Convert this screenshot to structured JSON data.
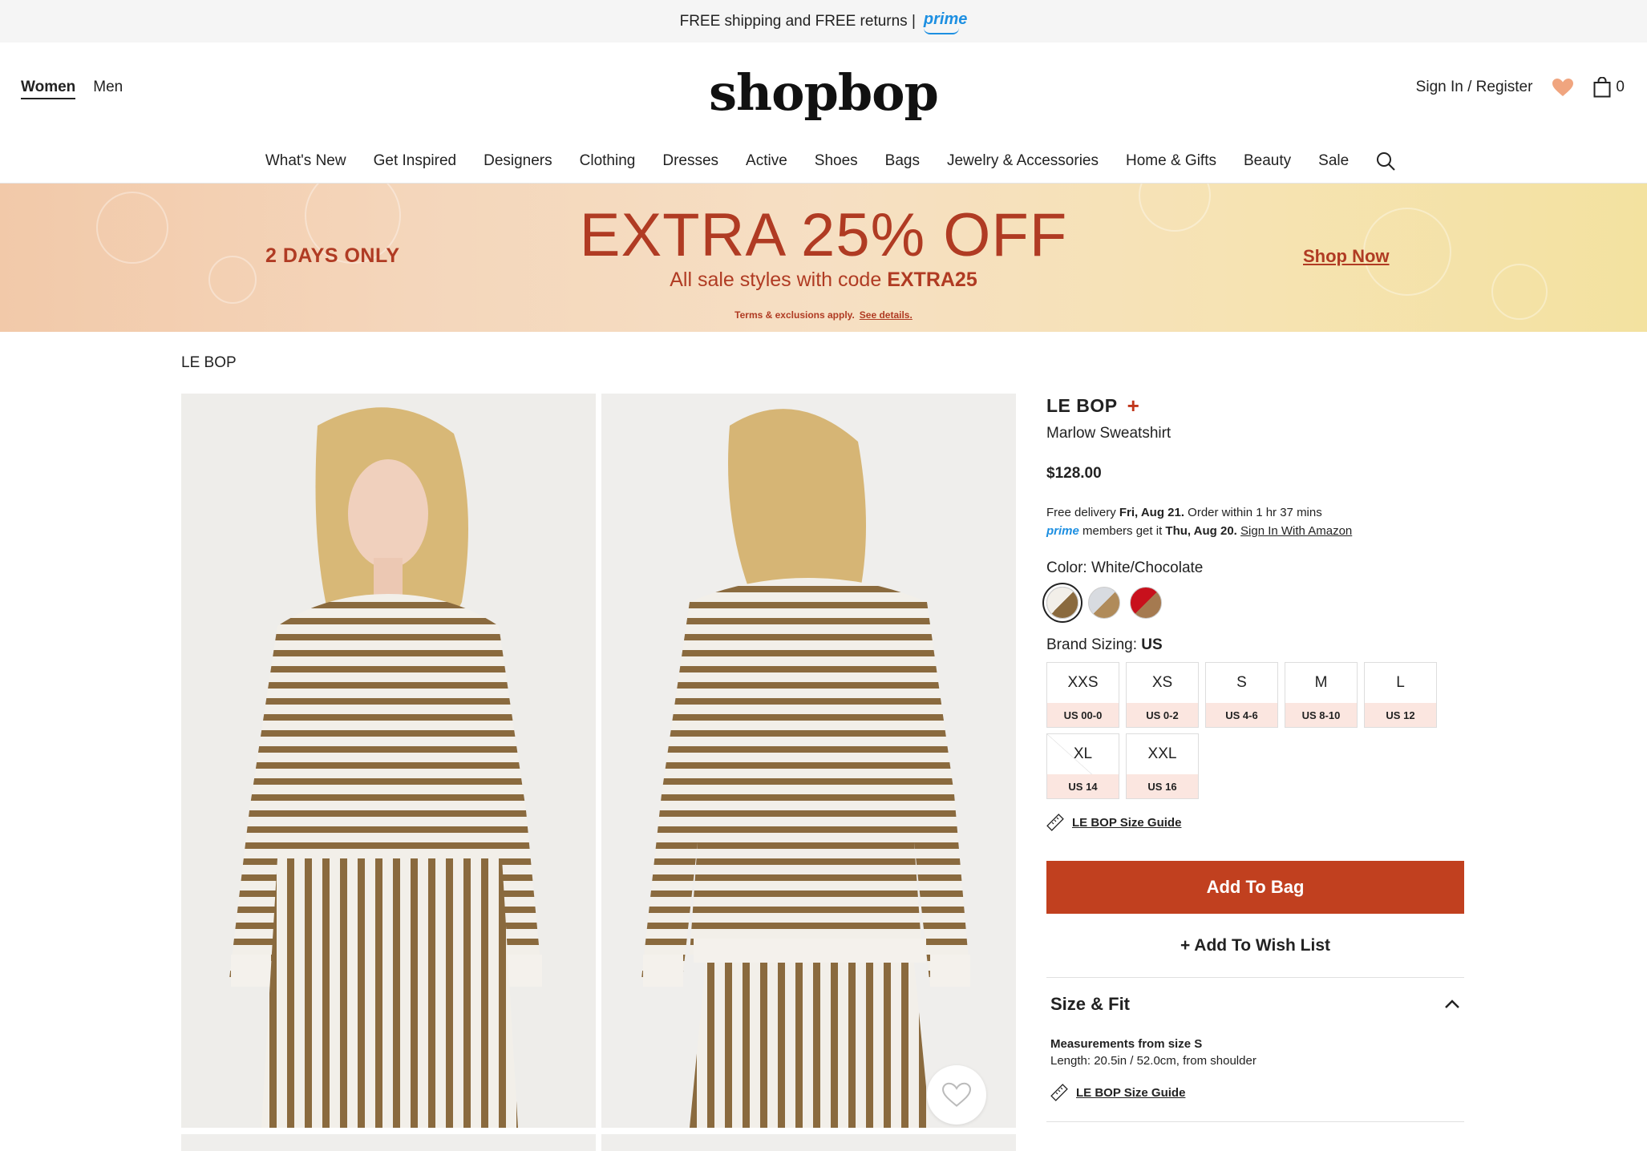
{
  "topbar": {
    "text": "FREE shipping and FREE returns |",
    "prime": "prime"
  },
  "header": {
    "gender_women": "Women",
    "gender_men": "Men",
    "logo": "shopbop",
    "sign_in": "Sign In / Register",
    "bag_count": "0"
  },
  "nav": {
    "items": [
      "What's New",
      "Get Inspired",
      "Designers",
      "Clothing",
      "Dresses",
      "Active",
      "Shoes",
      "Bags",
      "Jewelry & Accessories",
      "Home & Gifts",
      "Beauty",
      "Sale"
    ]
  },
  "promo": {
    "left": "2 DAYS ONLY",
    "headline": "EXTRA 25% OFF",
    "sub_prefix": "All sale styles with code",
    "code": "EXTRA25",
    "terms": "Terms & exclusions apply.",
    "terms_link": "See details.",
    "cta": "Shop Now"
  },
  "breadcrumb": "LE BOP",
  "product": {
    "brand": "LE BOP",
    "brand_plus": "+",
    "name": "Marlow Sweatshirt",
    "price": "$128.00",
    "delivery_1_prefix": "Free delivery",
    "delivery_1_date": "Fri, Aug 21.",
    "delivery_1_suffix": "Order within 1 hr 37 mins",
    "delivery_2_prime": "prime",
    "delivery_2_prefix": "members get it",
    "delivery_2_date": "Thu, Aug 20.",
    "delivery_2_link": "Sign In With Amazon",
    "color_label": "Color: White/Chocolate",
    "swatch_colors": [
      "#8a6a3e",
      "#b08b5a",
      "#c8101c"
    ],
    "size_label_prefix": "Brand Sizing:",
    "size_label_value": "US",
    "sizes": [
      {
        "size": "XXS",
        "us": "US 00-0"
      },
      {
        "size": "XS",
        "us": "US 0-2"
      },
      {
        "size": "S",
        "us": "US 4-6"
      },
      {
        "size": "M",
        "us": "US 8-10"
      },
      {
        "size": "L",
        "us": "US 12"
      },
      {
        "size": "XL",
        "us": "US 14"
      },
      {
        "size": "XXL",
        "us": "US 16"
      }
    ],
    "size_guide": "LE BOP Size Guide",
    "add_to_bag": "Add To Bag",
    "add_to_wishlist": "+ Add To Wish List"
  },
  "size_fit": {
    "title": "Size & Fit",
    "measure_title": "Measurements from size S",
    "measure_detail": "Length: 20.5in / 52.0cm, from shoulder",
    "guide": "LE BOP Size Guide"
  }
}
